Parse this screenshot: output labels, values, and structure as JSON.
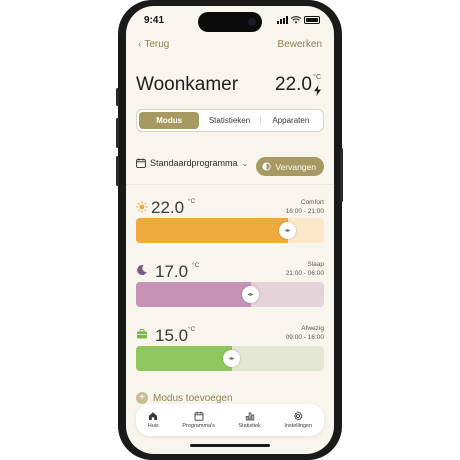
{
  "status": {
    "time": "9:41"
  },
  "nav": {
    "back_label": "Terug",
    "edit_label": "Bewerken"
  },
  "room": {
    "name": "Woonkamer",
    "temperature": "22.0",
    "unit": "°C"
  },
  "tabs": [
    {
      "label": "Modus",
      "active": true
    },
    {
      "label": "Statistieken",
      "active": false
    },
    {
      "label": "Apparaten",
      "active": false
    }
  ],
  "program": {
    "name": "Standaardprogramma",
    "replace_label": "Vervangen"
  },
  "modes": [
    {
      "icon": "sun-icon",
      "temperature": "22.0",
      "unit": "°C",
      "name": "Comfort",
      "time": "16:00 - 21:00",
      "level": 0.81,
      "color": "#f0a93c",
      "track": "#fbe8c8"
    },
    {
      "icon": "moon-icon",
      "temperature": "17.0",
      "unit": "°C",
      "name": "Slaap",
      "time": "21:00 - 06:00",
      "level": 0.61,
      "color": "#c493b6",
      "track": "#e4d3d8"
    },
    {
      "icon": "briefcase-icon",
      "temperature": "15.0",
      "unit": "°C",
      "name": "Afwezig",
      "time": "09:00 - 16:00",
      "level": 0.51,
      "color": "#8fc75c",
      "track": "#e3e6d2"
    }
  ],
  "add_mode_label": "Modus toevoegen",
  "tabbar": [
    {
      "icon": "home-icon",
      "label": "Huis"
    },
    {
      "icon": "calendar-icon",
      "label": "Programma's"
    },
    {
      "icon": "bar-chart-icon",
      "label": "Statistiek"
    },
    {
      "icon": "gear-icon",
      "label": "Instellingen"
    }
  ],
  "colors": {
    "accent": "#a89861",
    "accent_text": "#8f8050",
    "background": "#f8f5ee"
  }
}
